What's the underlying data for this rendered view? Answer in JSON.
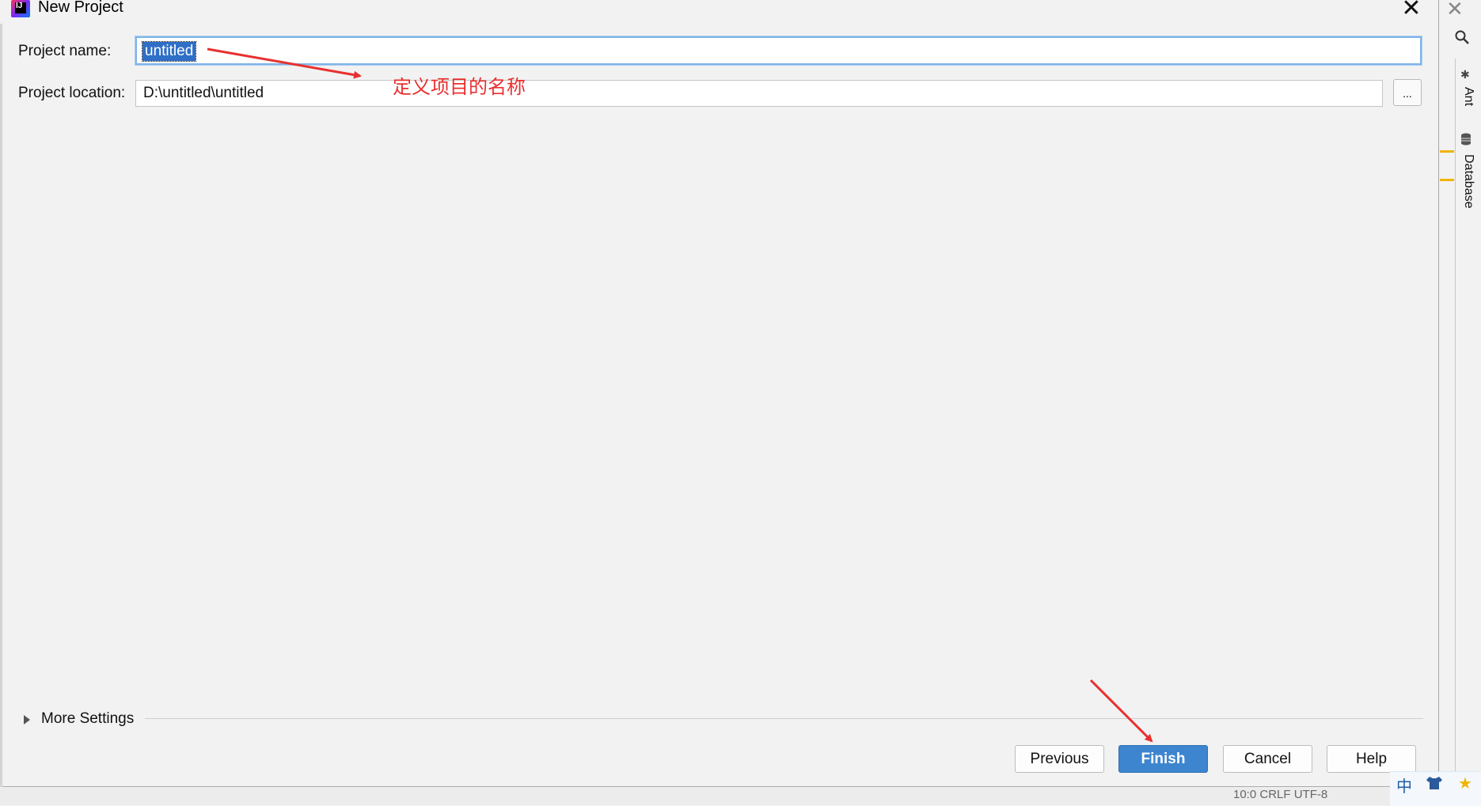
{
  "dialog": {
    "title": "New Project",
    "close_glyph": "✕"
  },
  "form": {
    "project_name_label": "Project name:",
    "project_name_value": "untitled",
    "project_location_label": "Project location:",
    "project_location_value": "D:\\untitled\\untitled",
    "browse_label": "..."
  },
  "annotations": {
    "name_note": "定义项目的名称",
    "color": "#e8302f"
  },
  "more_settings": {
    "label": "More Settings"
  },
  "buttons": {
    "previous": "Previous",
    "finish": "Finish",
    "cancel": "Cancel",
    "help": "Help"
  },
  "ide_strip": {
    "close_glyph": "✕",
    "ant_label": "Ant",
    "database_label": "Database"
  },
  "status": {
    "text": "10:0   CRLF   UTF-8"
  },
  "ime": {
    "mode": "中"
  },
  "colors": {
    "accent": "#3d85cf",
    "selection": "#2f6fc6",
    "highlight_marks": "#f0b400"
  }
}
